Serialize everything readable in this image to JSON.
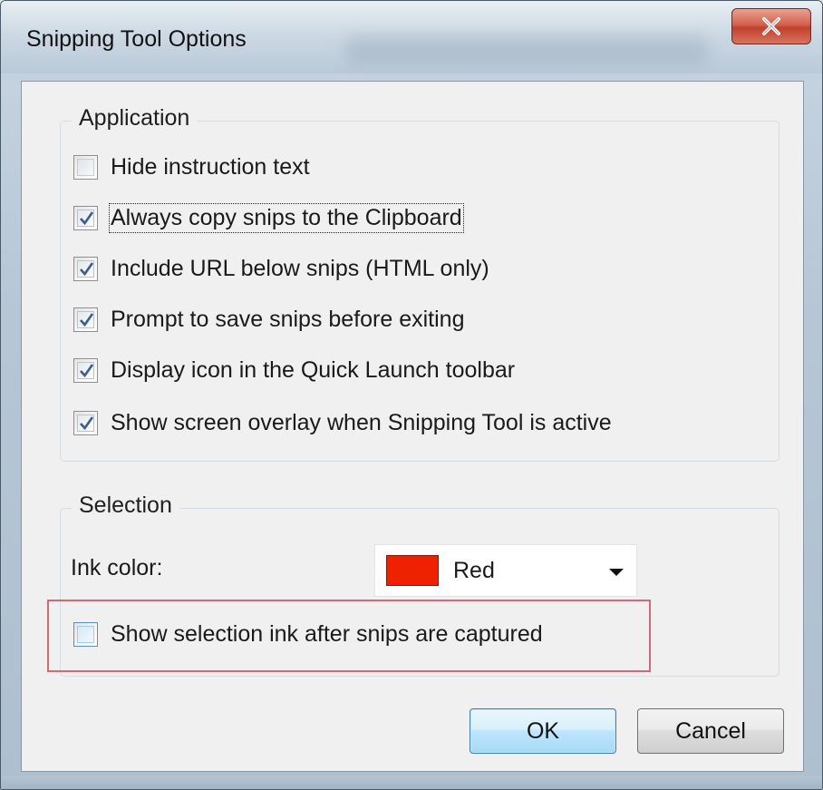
{
  "window": {
    "title": "Snipping Tool Options",
    "close_icon": "close-x-icon"
  },
  "application_group": {
    "legend": "Application",
    "options": [
      {
        "label": "Hide instruction text",
        "checked": false
      },
      {
        "label": "Always copy snips to the Clipboard",
        "checked": true,
        "focused": true
      },
      {
        "label": "Include URL below snips (HTML only)",
        "checked": true
      },
      {
        "label": "Prompt to save snips before exiting",
        "checked": true
      },
      {
        "label": "Display icon in the Quick Launch toolbar",
        "checked": true
      },
      {
        "label": "Show screen overlay when Snipping Tool is active",
        "checked": true
      }
    ]
  },
  "selection_group": {
    "legend": "Selection",
    "ink_color_label": "Ink color:",
    "ink_color": {
      "name": "Red",
      "swatch": "#ee2200"
    },
    "show_ink_option": {
      "label": "Show selection ink after snips are captured",
      "checked": false
    }
  },
  "buttons": {
    "ok": "OK",
    "cancel": "Cancel"
  },
  "colors": {
    "highlight_border": "#d06a74",
    "ok_button_border": "#3c7fb1"
  }
}
